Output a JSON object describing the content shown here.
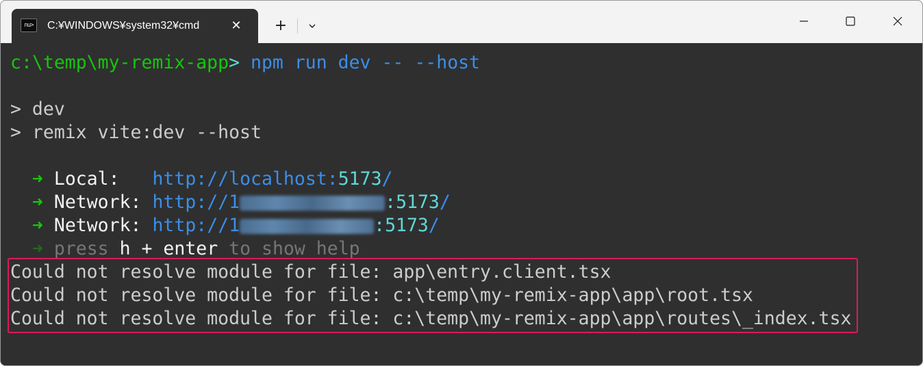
{
  "window": {
    "tab_title": "C:¥WINDOWS¥system32¥cmd",
    "tab_icon_text": "nu>",
    "tab_close_glyph": "✕",
    "new_tab_glyph": "+"
  },
  "terminal": {
    "prompt": {
      "path": "c:\\temp\\my-remix-app",
      "gt": ">",
      "command": " npm run dev -- --host"
    },
    "output": [
      "> dev",
      "> remix vite:dev --host"
    ],
    "arrow": "➜",
    "local": {
      "label": "Local:",
      "url_prefix": "http://localhost:",
      "port": "5173",
      "suffix": "/"
    },
    "network1": {
      "label": "Network:",
      "url_prefix": "http://1",
      "port_part": ":5173",
      "suffix": "/"
    },
    "network2": {
      "label": "Network:",
      "url_prefix": "http://1",
      "port_part": ":5173",
      "suffix": "/"
    },
    "help": {
      "press": "press",
      "key1": "h + enter",
      "rest": "to show help"
    },
    "errors": [
      "Could not resolve module for file: app\\entry.client.tsx",
      "Could not resolve module for file: c:\\temp\\my-remix-app\\app\\root.tsx",
      "Could not resolve module for file: c:\\temp\\my-remix-app\\app\\routes\\_index.tsx"
    ]
  },
  "colors": {
    "background": "#2f2f2f",
    "prompt_green": "#16c60c",
    "url_blue": "#3b8eea",
    "port_cyan": "#61d6d6",
    "highlight": "#e0185c"
  }
}
